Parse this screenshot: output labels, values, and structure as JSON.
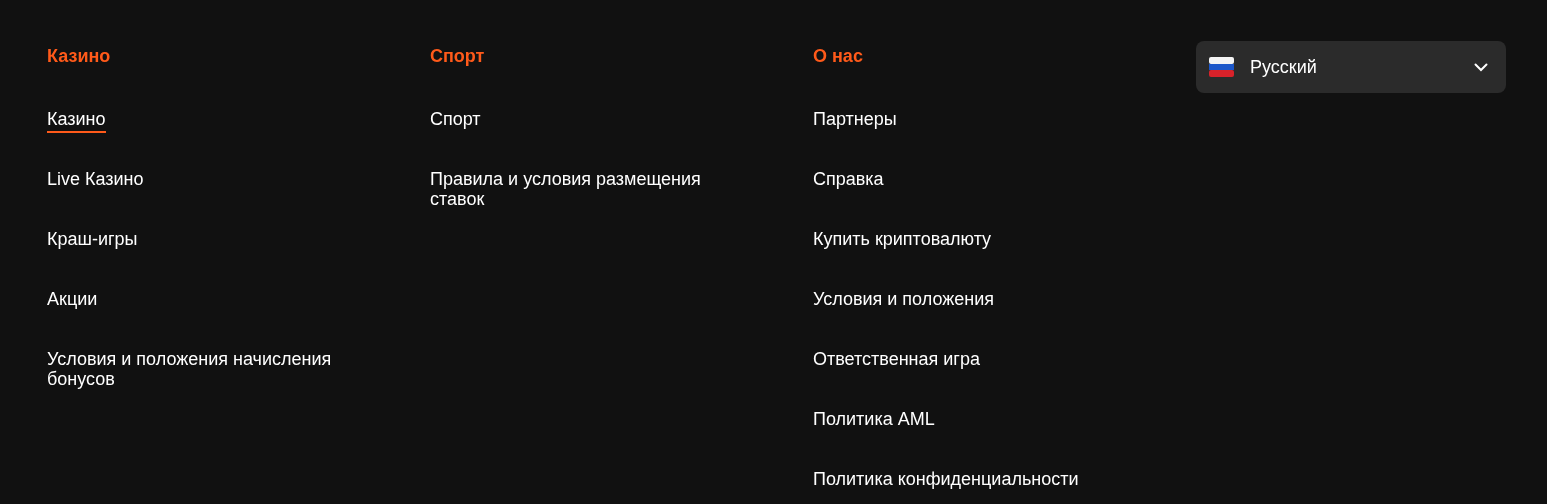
{
  "columns": [
    {
      "heading": "Казино",
      "links": [
        {
          "label": "Казино",
          "selected": true
        },
        {
          "label": "Live Казино",
          "selected": false
        },
        {
          "label": "Краш-игры",
          "selected": false
        },
        {
          "label": "Акции",
          "selected": false
        },
        {
          "label": "Условия и положения начисления бонусов",
          "selected": false
        }
      ]
    },
    {
      "heading": "Спорт",
      "links": [
        {
          "label": "Спорт",
          "selected": false
        },
        {
          "label": "Правила и условия размещения ставок",
          "selected": false
        }
      ]
    },
    {
      "heading": "О нас",
      "links": [
        {
          "label": "Партнеры",
          "selected": false
        },
        {
          "label": "Справка",
          "selected": false
        },
        {
          "label": "Купить криптовалюту",
          "selected": false
        },
        {
          "label": "Условия и положения",
          "selected": false
        },
        {
          "label": "Ответственная игра",
          "selected": false
        },
        {
          "label": "Политика AML",
          "selected": false
        },
        {
          "label": "Политика конфиденциальности",
          "selected": false
        }
      ]
    }
  ],
  "language": {
    "label": "Русский"
  }
}
